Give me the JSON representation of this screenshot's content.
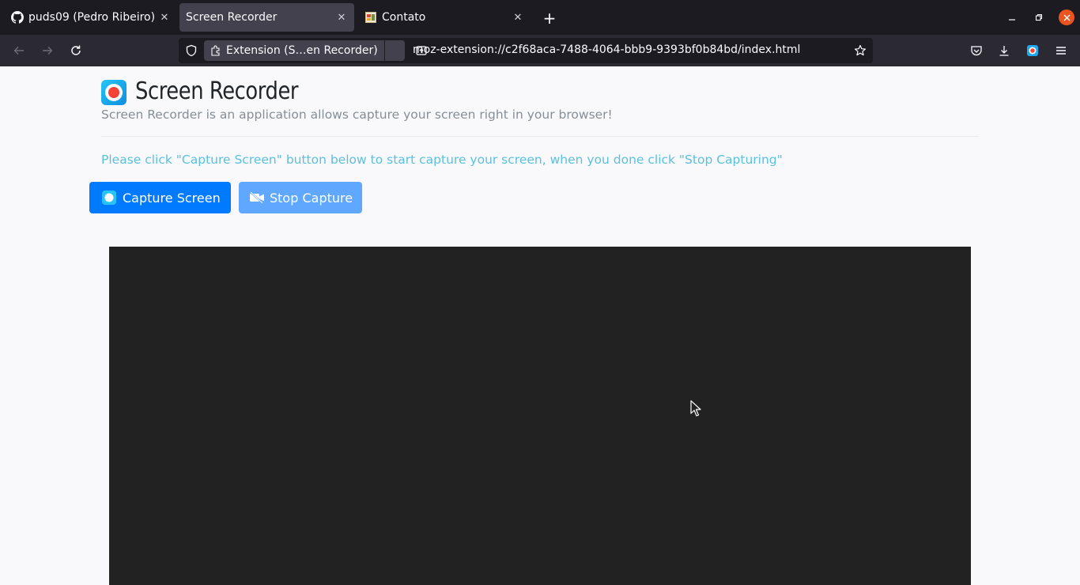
{
  "browser": {
    "tabs": [
      {
        "title": "puds09 (Pedro Ribeiro)",
        "icon": "github-icon",
        "active": false
      },
      {
        "title": "Screen Recorder",
        "icon": "none",
        "active": true
      },
      {
        "title": "Contato",
        "icon": "page-favicon-icon",
        "active": false
      }
    ],
    "identity_label": "Extension (S…en Recorder)",
    "url": "moz-extension://c2f68aca-7488-4064-bbb9-9393bf0b84bd/index.html",
    "close_glyph": "✕",
    "new_tab_glyph": "+"
  },
  "app": {
    "title": "Screen Recorder",
    "subtitle": "Screen Recorder is an application allows capture your screen right in your browser!",
    "instructions": "Please click \"Capture Screen\" button below to start capture your screen, when you done click \"Stop Capturing\"",
    "capture_button": "Capture Screen",
    "stop_button": "Stop Capture"
  },
  "colors": {
    "primary": "#007bff",
    "primary_disabled": "#60a8ff",
    "info_text": "#5bc0de",
    "video_bg": "#222222",
    "record_red": "#f44336"
  }
}
